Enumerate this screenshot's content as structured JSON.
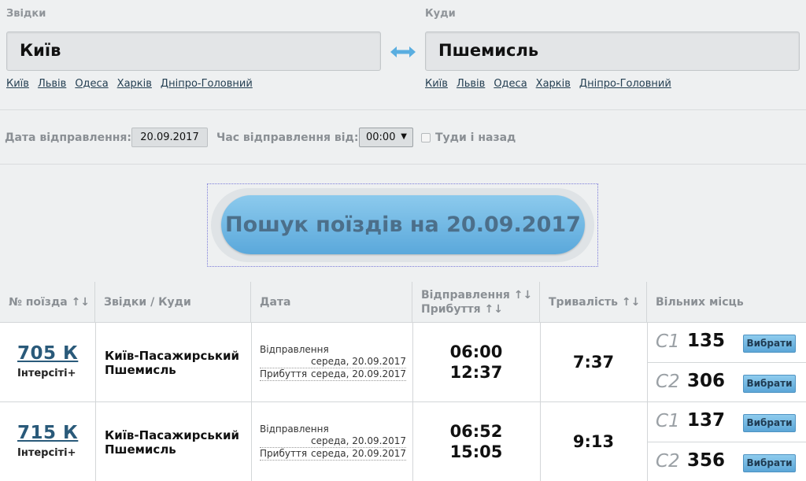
{
  "from": {
    "label": "Звідки",
    "value": "Київ",
    "quick": [
      "Київ",
      "Львів",
      "Одеса",
      "Харків",
      "Дніпро-Головний"
    ]
  },
  "to": {
    "label": "Куди",
    "value": "Пшемисль",
    "quick": [
      "Київ",
      "Львів",
      "Одеса",
      "Харків",
      "Дніпро-Головний"
    ]
  },
  "date_bar": {
    "date_label": "Дата відправлення:",
    "date_value": "20.09.2017",
    "time_label": "Час відправлення від:",
    "time_value": "00:00",
    "roundtrip_label": "Туди і назад"
  },
  "search": {
    "button_label": "Пошук поїздів на 20.09.2017"
  },
  "table": {
    "headers": {
      "train": "№ поїзда ↑↓",
      "route": "Звідки / Куди",
      "date": "Дата",
      "depart": "Відправлення ↑↓",
      "arrive": "Прибуття ↑↓",
      "duration": "Тривалість ↑↓",
      "seats": "Вільних місць"
    },
    "rows": [
      {
        "number": "705 К",
        "category": "Інтерсіті+",
        "from": "Київ-Пасажирський",
        "to": "Пшемисль",
        "depart_label": "Відправлення",
        "depart_date": "середа, 20.09.2017",
        "arrive_label": "Прибуття",
        "arrive_date": "середа, 20.09.2017",
        "depart_time": "06:00",
        "arrive_time": "12:37",
        "duration": "7:37",
        "seats": [
          {
            "class": "С1",
            "count": "135",
            "button": "Вибрати"
          },
          {
            "class": "С2",
            "count": "306",
            "button": "Вибрати"
          }
        ]
      },
      {
        "number": "715 К",
        "category": "Інтерсіті+",
        "from": "Київ-Пасажирський",
        "to": "Пшемисль",
        "depart_label": "Відправлення",
        "depart_date": "середа, 20.09.2017",
        "arrive_label": "Прибуття",
        "arrive_date": "середа, 20.09.2017",
        "depart_time": "06:52",
        "arrive_time": "15:05",
        "duration": "9:13",
        "seats": [
          {
            "class": "С1",
            "count": "137",
            "button": "Вибрати"
          },
          {
            "class": "С2",
            "count": "356",
            "button": "Вибрати"
          }
        ]
      }
    ]
  }
}
